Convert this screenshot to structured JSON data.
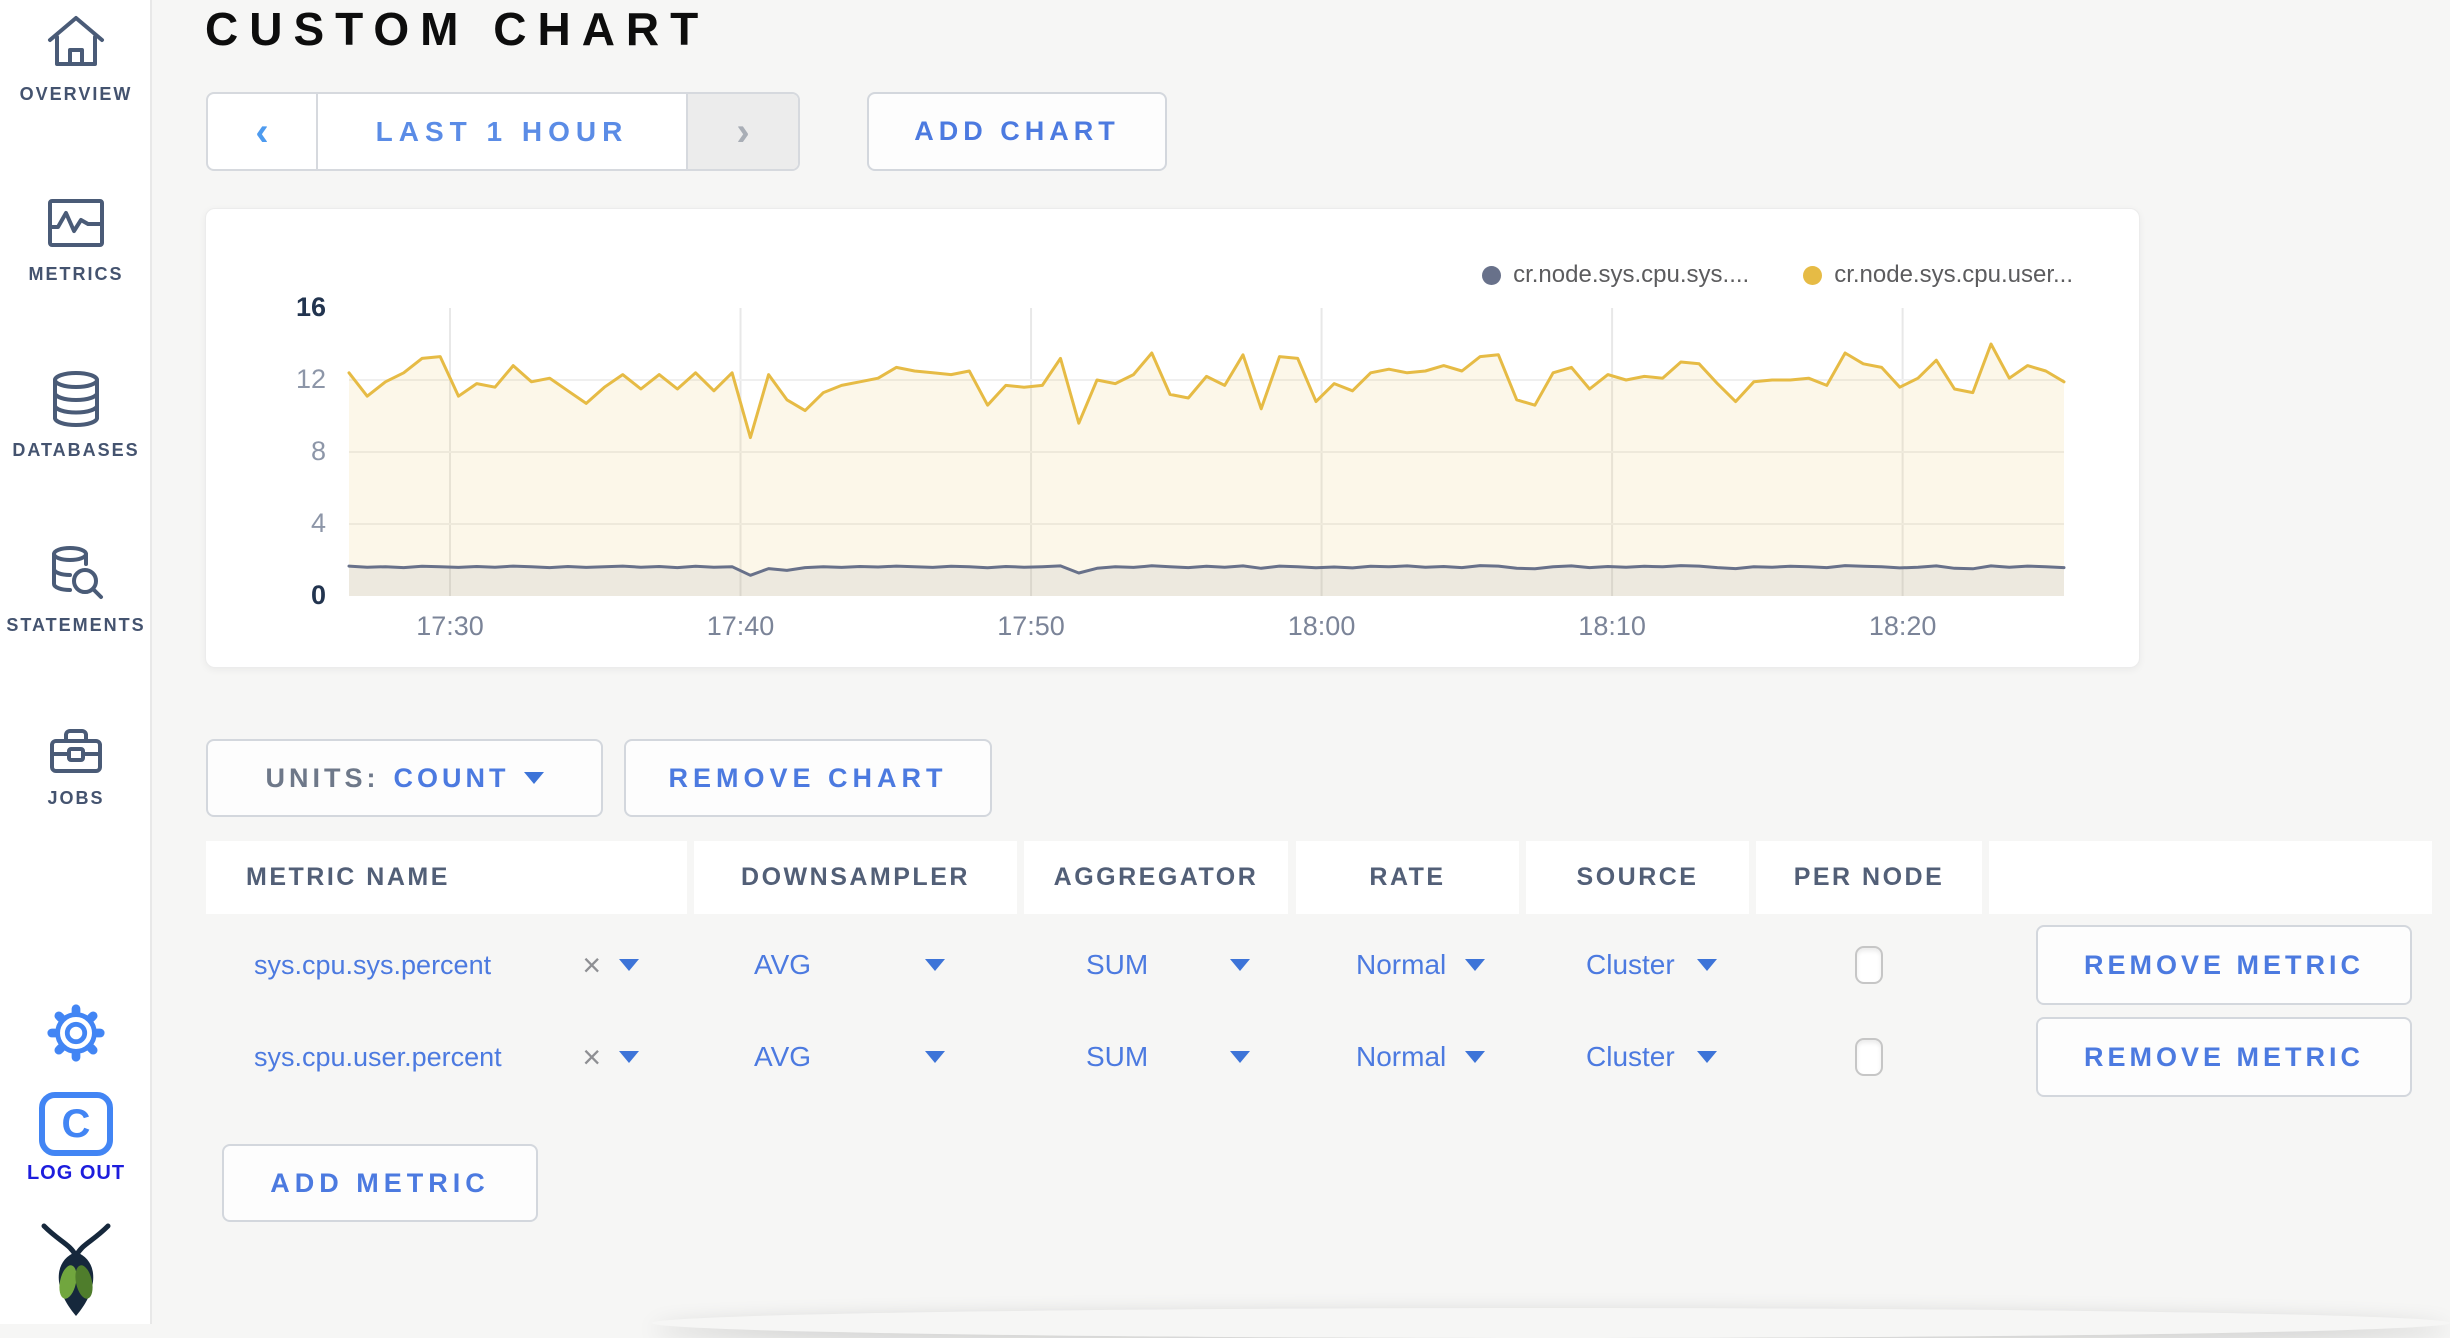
{
  "header": {
    "title": "CUSTOM CHART"
  },
  "toolbar": {
    "prev_glyph": "‹",
    "next_glyph": "›",
    "time_range_label": "LAST 1 HOUR",
    "add_chart_label": "ADD CHART"
  },
  "sidebar": {
    "items": [
      {
        "label": "OVERVIEW",
        "icon": "home-icon"
      },
      {
        "label": "METRICS",
        "icon": "metrics-icon"
      },
      {
        "label": "DATABASES",
        "icon": "databases-icon"
      },
      {
        "label": "STATEMENTS",
        "icon": "statements-icon"
      },
      {
        "label": "JOBS",
        "icon": "jobs-icon"
      }
    ],
    "gear_icon": "gear-icon",
    "c_logo_letter": "C",
    "logout_label": "LOG OUT",
    "brand_icon": "cockroach-logo-icon"
  },
  "chart_data": {
    "type": "line",
    "title": "",
    "xlabel": "",
    "ylabel": "",
    "x_axis": {
      "ticks": [
        "17:30",
        "17:40",
        "17:50",
        "18:00",
        "18:10",
        "18:20"
      ],
      "tick_fractions": [
        0.0589,
        0.2283,
        0.3977,
        0.5671,
        0.7365,
        0.9059
      ],
      "window": "17:26 - 18:25 (last 1 hour)"
    },
    "y_axis": {
      "ticks": [
        0,
        4,
        8,
        12,
        16
      ],
      "grid_values": [
        4,
        8,
        12
      ],
      "range": [
        0,
        16
      ]
    },
    "legend_position": "top-right",
    "grid": true,
    "series": [
      {
        "name": "cr.node.sys.cpu.sys....",
        "color": "#68718a",
        "fill": "rgba(104,113,138,0.10)",
        "values": [
          1.66,
          1.6,
          1.63,
          1.58,
          1.65,
          1.62,
          1.59,
          1.64,
          1.6,
          1.66,
          1.62,
          1.58,
          1.64,
          1.59,
          1.63,
          1.66,
          1.6,
          1.64,
          1.58,
          1.65,
          1.6,
          1.63,
          1.15,
          1.52,
          1.42,
          1.58,
          1.62,
          1.59,
          1.64,
          1.61,
          1.66,
          1.63,
          1.59,
          1.65,
          1.62,
          1.57,
          1.64,
          1.6,
          1.63,
          1.67,
          1.28,
          1.54,
          1.62,
          1.59,
          1.68,
          1.63,
          1.58,
          1.65,
          1.6,
          1.67,
          1.54,
          1.66,
          1.62,
          1.57,
          1.61,
          1.56,
          1.65,
          1.62,
          1.67,
          1.6,
          1.64,
          1.58,
          1.69,
          1.66,
          1.54,
          1.51,
          1.63,
          1.67,
          1.58,
          1.64,
          1.6,
          1.65,
          1.62,
          1.69,
          1.66,
          1.58,
          1.52,
          1.63,
          1.6,
          1.65,
          1.62,
          1.58,
          1.69,
          1.65,
          1.62,
          1.56,
          1.6,
          1.67,
          1.54,
          1.51,
          1.67,
          1.6,
          1.66,
          1.62,
          1.58
        ]
      },
      {
        "name": "cr.node.sys.cpu.user...",
        "color": "#e6bb45",
        "fill": "rgba(233,194,84,0.13)",
        "values": [
          12.4,
          11.1,
          11.9,
          12.4,
          13.2,
          13.3,
          11.1,
          11.8,
          11.6,
          12.8,
          11.9,
          12.1,
          11.4,
          10.7,
          11.6,
          12.3,
          11.5,
          12.3,
          11.5,
          12.4,
          11.4,
          12.4,
          8.8,
          12.3,
          10.9,
          10.3,
          11.3,
          11.7,
          11.9,
          12.1,
          12.7,
          12.5,
          12.4,
          12.3,
          12.5,
          10.6,
          11.7,
          11.6,
          11.7,
          13.2,
          9.6,
          12.0,
          11.8,
          12.3,
          13.5,
          11.2,
          11.0,
          12.2,
          11.7,
          13.4,
          10.4,
          13.3,
          13.2,
          10.8,
          11.8,
          11.4,
          12.4,
          12.6,
          12.4,
          12.5,
          12.8,
          12.5,
          13.3,
          13.4,
          10.9,
          10.6,
          12.4,
          12.7,
          11.5,
          12.3,
          12.0,
          12.2,
          12.1,
          13.0,
          12.9,
          11.8,
          10.8,
          11.9,
          12.0,
          12.0,
          12.1,
          11.7,
          13.5,
          12.9,
          12.7,
          11.6,
          12.1,
          13.1,
          11.5,
          11.3,
          14.0,
          12.1,
          12.8,
          12.5,
          11.9
        ]
      }
    ]
  },
  "units_control": {
    "label": "UNITS:",
    "value": "COUNT"
  },
  "remove_chart_label": "REMOVE CHART",
  "metrics_table": {
    "columns": [
      "METRIC NAME",
      "DOWNSAMPLER",
      "AGGREGATOR",
      "RATE",
      "SOURCE",
      "PER NODE",
      ""
    ],
    "rows": [
      {
        "name": "sys.cpu.sys.percent",
        "clear_glyph": "×",
        "downsampler": "AVG",
        "aggregator": "SUM",
        "rate": "Normal",
        "source": "Cluster",
        "per_node_checked": false,
        "remove_label": "REMOVE METRIC"
      },
      {
        "name": "sys.cpu.user.percent",
        "clear_glyph": "×",
        "downsampler": "AVG",
        "aggregator": "SUM",
        "rate": "Normal",
        "source": "Cluster",
        "per_node_checked": false,
        "remove_label": "REMOVE METRIC"
      }
    ],
    "add_metric_label": "ADD METRIC"
  }
}
